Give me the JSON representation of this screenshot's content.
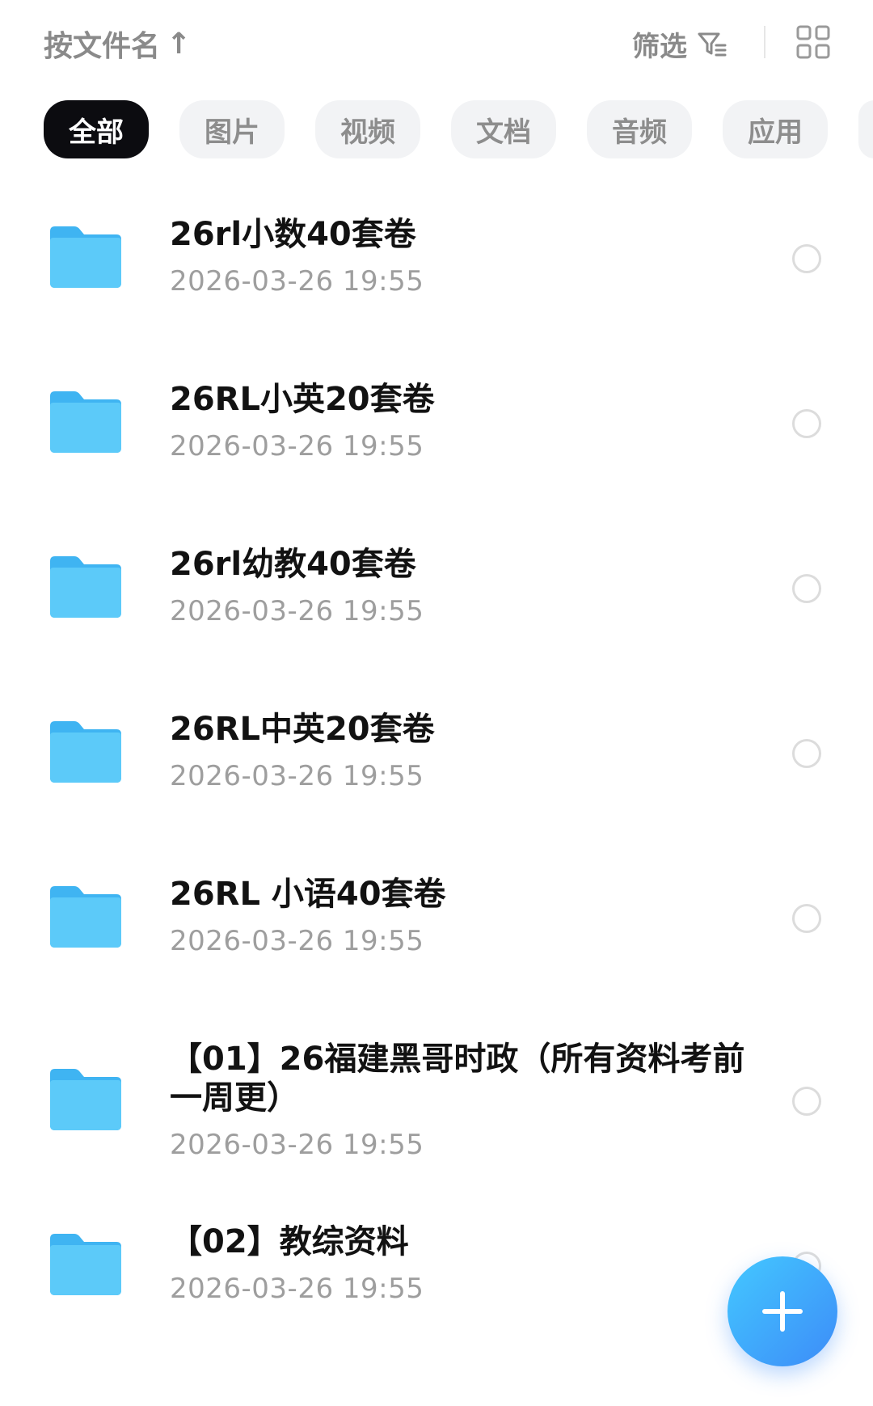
{
  "header": {
    "sort_label": "按文件名",
    "sort_arrow": "↑",
    "filter_label": "筛选"
  },
  "tabs": [
    {
      "label": "全部",
      "active": true
    },
    {
      "label": "图片",
      "active": false
    },
    {
      "label": "视频",
      "active": false
    },
    {
      "label": "文档",
      "active": false
    },
    {
      "label": "音频",
      "active": false
    },
    {
      "label": "应用",
      "active": false
    }
  ],
  "files": [
    {
      "name": "26rl小数40套卷",
      "time": "2026-03-26  19:55"
    },
    {
      "name": "26RL小英20套卷",
      "time": "2026-03-26  19:55"
    },
    {
      "name": "26rl幼教40套卷",
      "time": "2026-03-26  19:55"
    },
    {
      "name": "26RL中英20套卷",
      "time": "2026-03-26  19:55"
    },
    {
      "name": "26RL 小语40套卷",
      "time": "2026-03-26  19:55"
    },
    {
      "name": "【01】26福建黑哥时政（所有资料考前一周更）",
      "time": "2026-03-26  19:55"
    },
    {
      "name": "【02】教综资料",
      "time": "2026-03-26  19:55"
    }
  ],
  "colors": {
    "folder": "#4fc3f7",
    "fab_start": "#43c8ff",
    "fab_end": "#3d8cf8",
    "active_chip": "#0c0c10"
  },
  "icons": {
    "filter": "filter-icon",
    "grid": "grid-view-icon",
    "folder": "folder-icon",
    "add": "plus-icon"
  }
}
